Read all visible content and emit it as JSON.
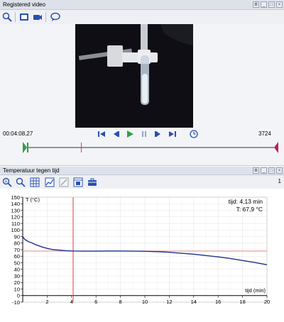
{
  "video_panel": {
    "title": "Registered video",
    "timecode": "00:04:08,27",
    "frame_count": "3724",
    "playhead_fraction": 0.22
  },
  "graph_panel": {
    "title": "Temperatuur tegen tijd",
    "page": "1"
  },
  "icons": {
    "search": "search-icon",
    "video_frame": "video-frame-icon",
    "camera": "camera-icon",
    "chat": "chat-icon",
    "zoom_fit": "zoom-fit-icon",
    "zoom": "zoom-icon",
    "table": "table-icon",
    "graph": "graph-icon",
    "graph_settings": "graph-settings-icon",
    "export": "export-icon",
    "toolbox": "toolbox-icon"
  },
  "colors": {
    "accent_blue": "#2a4fb0",
    "marker_red": "#e03a3a",
    "play_green": "#2ea043",
    "curve": "#1f2f8c"
  },
  "chart_data": {
    "type": "line",
    "title": "",
    "ylabel": "T (°C)",
    "xlabel": "tijd (min)",
    "xlim": [
      0,
      20
    ],
    "ylim": [
      -10,
      150
    ],
    "xticks": [
      2,
      4,
      6,
      8,
      10,
      12,
      14,
      16,
      18,
      20
    ],
    "yticks": [
      -10,
      0,
      10,
      20,
      30,
      40,
      50,
      60,
      70,
      80,
      90,
      100,
      110,
      120,
      130,
      140,
      150
    ],
    "grid": true,
    "cursor": {
      "x": 4.13,
      "y": 67.9
    },
    "readout": {
      "x_text": "tijd: 4,13 min",
      "y_text": "T: 67,9 °C"
    },
    "series": [
      {
        "x": [
          0,
          0.15,
          0.3,
          0.5,
          0.8,
          1.0,
          1.3,
          1.6,
          2.0,
          2.5,
          3.0,
          3.5,
          4.13,
          5,
          6,
          7,
          8,
          9,
          10,
          11,
          12,
          13,
          14,
          15,
          16,
          17,
          18,
          19,
          20
        ],
        "y": [
          90,
          86,
          84,
          82,
          80,
          78,
          76,
          74,
          72,
          70,
          69.2,
          68.5,
          67.9,
          67.8,
          67.8,
          67.9,
          67.9,
          67.8,
          67.5,
          67,
          66,
          64.5,
          63,
          61,
          59,
          56.5,
          53.5,
          50.5,
          47
        ]
      }
    ]
  }
}
